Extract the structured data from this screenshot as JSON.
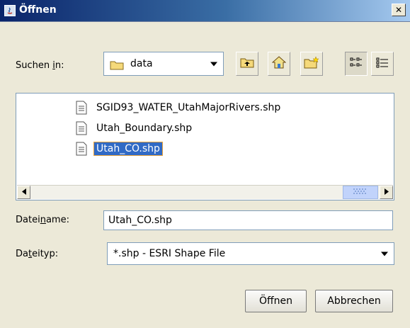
{
  "window": {
    "title": "Öffnen",
    "close_glyph": "✕"
  },
  "lookin": {
    "label_pre": "Suchen ",
    "label_u": "i",
    "label_post": "n:",
    "value": "data"
  },
  "toolbar": {
    "icons": [
      "up-folder-icon",
      "home-icon",
      "new-folder-icon",
      "list-view-icon",
      "details-view-icon"
    ]
  },
  "files": [
    {
      "name": "SGID93_WATER_UtahMajorRivers.shp",
      "selected": false
    },
    {
      "name": "Utah_Boundary.shp",
      "selected": false
    },
    {
      "name": "Utah_CO.shp",
      "selected": true
    }
  ],
  "filename": {
    "label_pre": "Datei",
    "label_u": "n",
    "label_post": "ame:",
    "value": "Utah_CO.shp"
  },
  "filetype": {
    "label_pre": "Da",
    "label_u": "t",
    "label_post": "eityp:",
    "value": "*.shp - ESRI Shape File"
  },
  "buttons": {
    "open": "Öffnen",
    "cancel": "Abbrechen"
  },
  "colors": {
    "title_start": "#0a246a",
    "title_end": "#a6caf0",
    "selection": "#316ac5",
    "dialog_bg": "#ece9d8"
  }
}
